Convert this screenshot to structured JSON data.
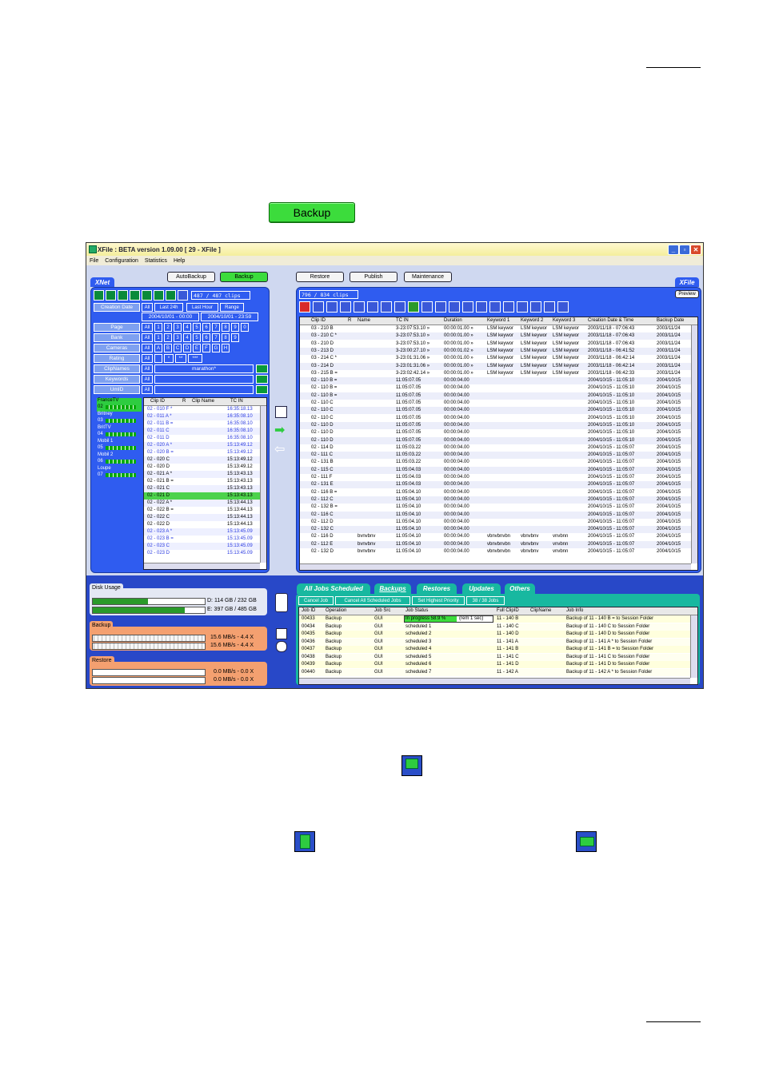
{
  "big_button": {
    "label": "Backup"
  },
  "window": {
    "title": "XFile : BETA version 1.09.00 [ 29 - XFile ]"
  },
  "menu": [
    "File",
    "Configuration",
    "Statistics",
    "Help"
  ],
  "top_buttons": {
    "autobackup": "AutoBackup",
    "backup": "Backup",
    "restore": "Restore",
    "publish": "Publish",
    "maintenance": "Maintenance"
  },
  "xnet": {
    "tab": "XNet",
    "count": "487 / 487 clips",
    "filters": {
      "creation_date": "Creation Date",
      "all": "All",
      "last24h": "Last 24h",
      "last_hour": "Last Hour",
      "range": "Range",
      "date_from": "2004/10/01 - 00:00",
      "date_to": "2004/10/01 - 23:59",
      "page": "Page",
      "bank": "Bank",
      "cameras": "Cameras",
      "rating": "Rating",
      "clipnames": "ClipNames",
      "clipnames_value": "marathon*",
      "keywords": "Keywords",
      "umid": "UmID",
      "digits": [
        "1",
        "2",
        "3",
        "4",
        "5",
        "6",
        "7",
        "8",
        "9",
        "0"
      ],
      "bank_digits": [
        "1",
        "2",
        "3",
        "4",
        "5",
        "6",
        "7",
        "8",
        "9"
      ],
      "cams": [
        "A",
        "B",
        "C",
        "D",
        "E",
        "F",
        "G",
        "H"
      ],
      "rating_vals": [
        "*",
        "**",
        "***"
      ]
    },
    "servers": [
      {
        "name": "FranceTV",
        "num": "02"
      },
      {
        "name": "Britney",
        "num": "03"
      },
      {
        "name": "BritTV",
        "num": "04"
      },
      {
        "name": "Mobil 1",
        "num": "05"
      },
      {
        "name": "Mobil 2",
        "num": "06"
      },
      {
        "name": "Loupe",
        "num": "07"
      }
    ],
    "columns": [
      "Clip ID",
      "R",
      "Clip Name",
      "TC IN"
    ],
    "rows": [
      [
        "02 - 010 F *",
        "",
        "16:35:18.13"
      ],
      [
        "02 - 011 A *",
        "",
        "16:35:08.10"
      ],
      [
        "02 - 011 B =",
        "",
        "16:35:08.10"
      ],
      [
        "02 - 011 C",
        "",
        "16:35:08.10"
      ],
      [
        "02 - 011 D",
        "",
        "16:35:08.10"
      ],
      [
        "02 - 020 A *",
        "",
        "15:13:49.12"
      ],
      [
        "02 - 020 B =",
        "",
        "15:13:49.12"
      ],
      [
        "02 - 020 C",
        "",
        "15:13:49.12"
      ],
      [
        "02 - 020 D",
        "",
        "15:13:49.12"
      ],
      [
        "02 - 021 A *",
        "",
        "15:13:43.13"
      ],
      [
        "02 - 021 B =",
        "",
        "15:13:43.13"
      ],
      [
        "02 - 021 C",
        "",
        "15:13:43.13"
      ],
      [
        "02 - 021 D",
        "",
        "15:13:43.13"
      ],
      [
        "02 - 022 A *",
        "",
        "15:13:44.13"
      ],
      [
        "02 - 022 B =",
        "",
        "15:13:44.13"
      ],
      [
        "02 - 022 C",
        "",
        "15:13:44.13"
      ],
      [
        "02 - 022 D",
        "",
        "15:13:44.13"
      ],
      [
        "02 - 023 A *",
        "",
        "15:13:45.09"
      ],
      [
        "02 - 023 B =",
        "",
        "15:13:45.09"
      ],
      [
        "02 - 023 C",
        "",
        "15:13:45.09"
      ],
      [
        "02 - 023 D",
        "",
        "15:13:45.09"
      ]
    ],
    "selected_row": 12
  },
  "xfile": {
    "tab": "XFile",
    "preview": "Preview",
    "count": "796 / 834 clips",
    "columns": [
      "Clip ID",
      "R",
      "Name",
      "TC IN",
      "Duration",
      "Keyword 1",
      "Keyword 2",
      "Keyword 3",
      "Creation Date & Time",
      "Backup Date"
    ],
    "rows": [
      [
        "03 - 210 B",
        "",
        "3-23:07:53.10 »",
        "00:00:01.00 »",
        "LSM keywor",
        "LSM keywor",
        "LSM keywor",
        "2003/11/18 - 07:06:43",
        "2003/11/24"
      ],
      [
        "03 - 210 C *",
        "",
        "3-23:07:53.10 »",
        "00:00:01.00 »",
        "LSM keywor",
        "LSM keywor",
        "LSM keywor",
        "2003/11/18 - 07:06:43",
        "2003/11/24"
      ],
      [
        "03 - 210 D",
        "",
        "3-23:07:53.10 »",
        "00:00:01.00 »",
        "LSM keywor",
        "LSM keywor",
        "LSM keywor",
        "2003/11/18 - 07:06:43",
        "2003/11/24"
      ],
      [
        "03 - 213 D",
        "",
        "3-23:00:27.10 »",
        "00:00:01.02 »",
        "LSM keywor",
        "LSM keywor",
        "LSM keywor",
        "2003/11/18 - 06:41:52",
        "2003/11/24"
      ],
      [
        "03 - 214 C *",
        "",
        "3-23:01:31.06 »",
        "00:00:01.00 »",
        "LSM keywor",
        "LSM keywor",
        "LSM keywor",
        "2003/11/18 - 06:42:14",
        "2003/11/24"
      ],
      [
        "03 - 214 D",
        "",
        "3-23:01:31.06 »",
        "00:00:01.00 »",
        "LSM keywor",
        "LSM keywor",
        "LSM keywor",
        "2003/11/18 - 06:42:14",
        "2003/11/24"
      ],
      [
        "03 - 215 B =",
        "",
        "3-23:02:42.14 »",
        "00:00:01.00 »",
        "LSM keywor",
        "LSM keywor",
        "LSM keywor",
        "2003/11/18 - 06:42:33",
        "2003/11/24"
      ],
      [
        "02 - 110 B =",
        "",
        "11:05:07.05",
        "00:00:04.00",
        "",
        "",
        "",
        "2004/10/15 - 11:05:10",
        "2004/10/15"
      ],
      [
        "02 - 110 B =",
        "",
        "11:05:07.05",
        "00:00:04.00",
        "",
        "",
        "",
        "2004/10/15 - 11:05:10",
        "2004/10/15"
      ],
      [
        "02 - 110 B =",
        "",
        "11:05:07.05",
        "00:00:04.00",
        "",
        "",
        "",
        "2004/10/15 - 11:05:10",
        "2004/10/15"
      ],
      [
        "02 - 110 C",
        "",
        "11:05:07.05",
        "00:00:04.00",
        "",
        "",
        "",
        "2004/10/15 - 11:05:10",
        "2004/10/15"
      ],
      [
        "02 - 110 C",
        "",
        "11:05:07.05",
        "00:00:04.00",
        "",
        "",
        "",
        "2004/10/15 - 11:05:10",
        "2004/10/15"
      ],
      [
        "02 - 110 C",
        "",
        "11:05:07.05",
        "00:00:04.00",
        "",
        "",
        "",
        "2004/10/15 - 11:05:10",
        "2004/10/15"
      ],
      [
        "02 - 110 D",
        "",
        "11:05:07.05",
        "00:00:04.00",
        "",
        "",
        "",
        "2004/10/15 - 11:05:10",
        "2004/10/15"
      ],
      [
        "02 - 110 D",
        "",
        "11:05:07.05",
        "00:00:04.00",
        "",
        "",
        "",
        "2004/10/15 - 11:05:10",
        "2004/10/15"
      ],
      [
        "02 - 110 D",
        "",
        "11:05:07.05",
        "00:00:04.00",
        "",
        "",
        "",
        "2004/10/15 - 11:05:10",
        "2004/10/15"
      ],
      [
        "02 - 114 D",
        "",
        "11:05:03.22",
        "00:00:04.00",
        "",
        "",
        "",
        "2004/10/15 - 11:05:07",
        "2004/10/15"
      ],
      [
        "02 - 111 C",
        "",
        "11:05:03.22",
        "00:00:04.00",
        "",
        "",
        "",
        "2004/10/15 - 11:05:07",
        "2004/10/15"
      ],
      [
        "02 - 131 B",
        "",
        "11:05:03.22",
        "00:00:04.00",
        "",
        "",
        "",
        "2004/10/15 - 11:05:07",
        "2004/10/15"
      ],
      [
        "02 - 115 C",
        "",
        "11:05:04.03",
        "00:00:04.00",
        "",
        "",
        "",
        "2004/10/15 - 11:05:07",
        "2004/10/15"
      ],
      [
        "02 - 111 F",
        "",
        "11:05:04.03",
        "00:00:04.00",
        "",
        "",
        "",
        "2004/10/15 - 11:05:07",
        "2004/10/15"
      ],
      [
        "02 - 131 E",
        "",
        "11:05:04.03",
        "00:00:04.00",
        "",
        "",
        "",
        "2004/10/15 - 11:05:07",
        "2004/10/15"
      ],
      [
        "02 - 116 B =",
        "",
        "11:05:04.10",
        "00:00:04.00",
        "",
        "",
        "",
        "2004/10/15 - 11:05:07",
        "2004/10/15"
      ],
      [
        "02 - 112 C",
        "",
        "11:05:04.10",
        "00:00:04.00",
        "",
        "",
        "",
        "2004/10/15 - 11:05:07",
        "2004/10/15"
      ],
      [
        "02 - 132 B =",
        "",
        "11:05:04.10",
        "00:00:04.00",
        "",
        "",
        "",
        "2004/10/15 - 11:05:07",
        "2004/10/15"
      ],
      [
        "02 - 116 C",
        "",
        "11:05:04.10",
        "00:00:04.00",
        "",
        "",
        "",
        "2004/10/15 - 11:05:07",
        "2004/10/15"
      ],
      [
        "02 - 112 D",
        "",
        "11:05:04.10",
        "00:00:04.00",
        "",
        "",
        "",
        "2004/10/15 - 11:05:07",
        "2004/10/15"
      ],
      [
        "02 - 132 C",
        "",
        "11:05:04.10",
        "00:00:04.00",
        "",
        "",
        "",
        "2004/10/15 - 11:05:07",
        "2004/10/15"
      ],
      [
        "02 - 116 D",
        "bvnvbnv",
        "11:05:04.10",
        "00:00:04.00",
        "vbnvbnvbn",
        "vbnvbnv",
        "vnvbnn",
        "2004/10/15 - 11:05:07",
        "2004/10/15"
      ],
      [
        "02 - 112 E",
        "bvnvbnv",
        "11:05:04.10",
        "00:00:04.00",
        "vbnvbnvbn",
        "vbnvbnv",
        "vnvbnn",
        "2004/10/15 - 11:05:07",
        "2004/10/15"
      ],
      [
        "02 - 132 D",
        "bvnvbnv",
        "11:05:04.10",
        "00:00:04.00",
        "vbnvbnvbn",
        "vbnvbnv",
        "vnvbnn",
        "2004/10/15 - 11:05:07",
        "2004/10/15"
      ]
    ]
  },
  "disk": {
    "label": "Disk Usage",
    "d": "D: 114 GB / 232 GB",
    "e": "E: 397 GB / 485 GB",
    "d_fraction": 0.49,
    "e_fraction": 0.82
  },
  "backup_rates": {
    "label": "Backup",
    "r1": "15.6 MB/s - 4.4 X",
    "r2": "15.6 MB/s - 4.4 X"
  },
  "restore_rates": {
    "label": "Restore",
    "r1": "0.0 MB/s - 0.0 X",
    "r2": "0.0 MB/s - 0.0 X"
  },
  "jobs": {
    "tabs": [
      "All Jobs Scheduled",
      "Backups",
      "Restores",
      "Updates",
      "Others"
    ],
    "actions": [
      "Cancel Job",
      "Cancel All Scheduled Jobs",
      "Set Highest Priority",
      "38 / 38 Jobs"
    ],
    "columns": [
      "Job ID",
      "Operation",
      "Job Src",
      "Job Status",
      "Full ClipID",
      "ClipName",
      "Job Info"
    ],
    "progress_label": "In progress 58.9 %",
    "progress_extra": "(rem 1 sec)",
    "progress_fraction": 0.589,
    "rows": [
      [
        "00433",
        "Backup",
        "GUI",
        "",
        "11 - 140 B",
        "",
        "Backup of 11 - 140 B = to Session Folder"
      ],
      [
        "00434",
        "Backup",
        "GUI",
        "scheduled 1",
        "11 - 140 C",
        "",
        "Backup of 11 - 140 C to Session Folder"
      ],
      [
        "00435",
        "Backup",
        "GUI",
        "scheduled 2",
        "11 - 140 D",
        "",
        "Backup of 11 - 140 D to Session Folder"
      ],
      [
        "00436",
        "Backup",
        "GUI",
        "scheduled 3",
        "11 - 141 A",
        "",
        "Backup of 11 - 141 A * to Session Folder"
      ],
      [
        "00437",
        "Backup",
        "GUI",
        "scheduled 4",
        "11 - 141 B",
        "",
        "Backup of 11 - 141 B = to Session Folder"
      ],
      [
        "00438",
        "Backup",
        "GUI",
        "scheduled 5",
        "11 - 141 C",
        "",
        "Backup of 11 - 141 C to Session Folder"
      ],
      [
        "00439",
        "Backup",
        "GUI",
        "scheduled 6",
        "11 - 141 D",
        "",
        "Backup of 11 - 141 D to Session Folder"
      ],
      [
        "00440",
        "Backup",
        "GUI",
        "scheduled 7",
        "11 - 142 A",
        "",
        "Backup of 11 - 142 A * to Session Folder"
      ]
    ]
  }
}
